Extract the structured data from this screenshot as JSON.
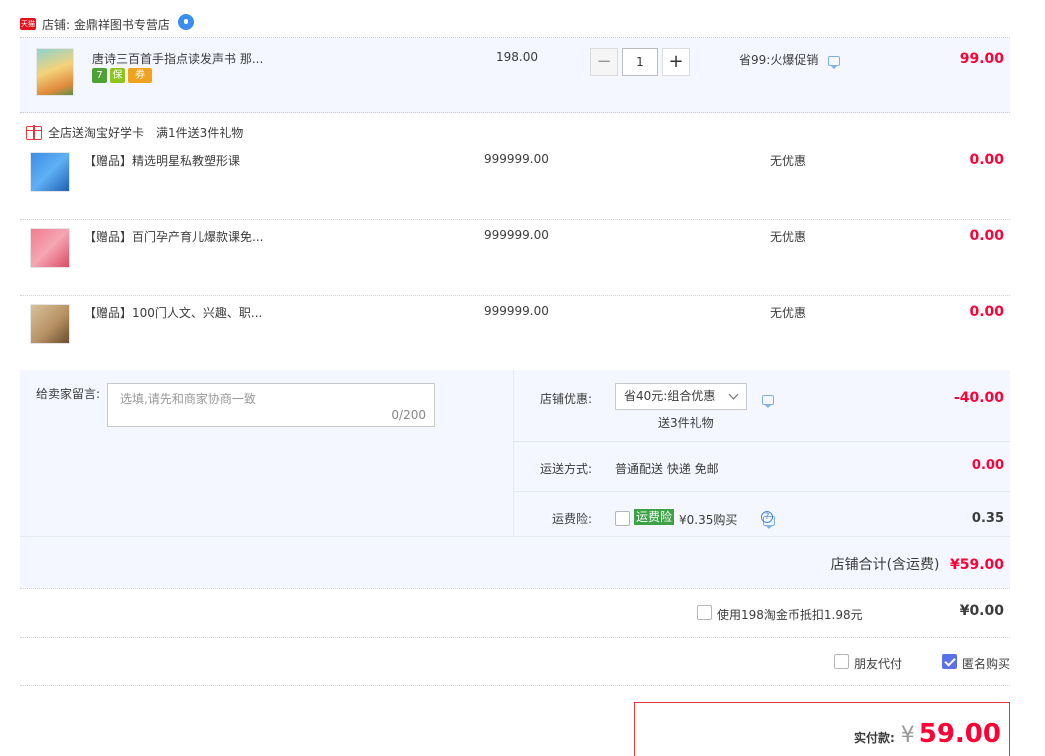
{
  "shop": {
    "badge": "天猫",
    "label": "店铺: 金鼎祥图书专营店"
  },
  "main_item": {
    "title": "唐诗三百首手指点读发声书 那...",
    "tags": [
      "7",
      "保",
      "券"
    ],
    "price": "198.00",
    "quantity": "1",
    "minus": "−",
    "plus": "+",
    "promo": "省99:火爆促销",
    "subtotal": "99.00"
  },
  "gift_promo": {
    "name": "全店送淘宝好学卡",
    "rule": "满1件送3件礼物"
  },
  "gifts": [
    {
      "title": "【赠品】精选明星私教塑形课",
      "price": "999999.00",
      "discount": "无优惠",
      "subtotal": "0.00"
    },
    {
      "title": "【赠品】百门孕产育儿爆款课免...",
      "price": "999999.00",
      "discount": "无优惠",
      "subtotal": "0.00"
    },
    {
      "title": "【赠品】100门人文、兴趣、职...",
      "price": "999999.00",
      "discount": "无优惠",
      "subtotal": "0.00"
    }
  ],
  "order": {
    "message_label": "给卖家留言:",
    "message_placeholder": "选填,请先和商家协商一致",
    "message_count": "0/200",
    "coupon_label": "店铺优惠:",
    "coupon_selected": "省40元:组合优惠",
    "coupon_note": "送3件礼物",
    "coupon_value": "-40.00",
    "shipping_label": "运送方式:",
    "shipping_value": "普通配送 快递 免邮",
    "shipping_cost": "0.00",
    "insurance_label": "运费险:",
    "insurance_tag": "运费险",
    "insurance_text": "¥0.35购买",
    "insurance_cost": "0.35",
    "total_label": "店铺合计(含运费)",
    "total_value": "¥59.00"
  },
  "coins": {
    "label": "使用198淘金币抵扣1.98元",
    "value": "¥0.00"
  },
  "options": {
    "friend_pay": "朋友代付",
    "anonymous": "匿名购买"
  },
  "payment": {
    "label": "实付款:",
    "currency": "¥",
    "amount": "59.00"
  }
}
